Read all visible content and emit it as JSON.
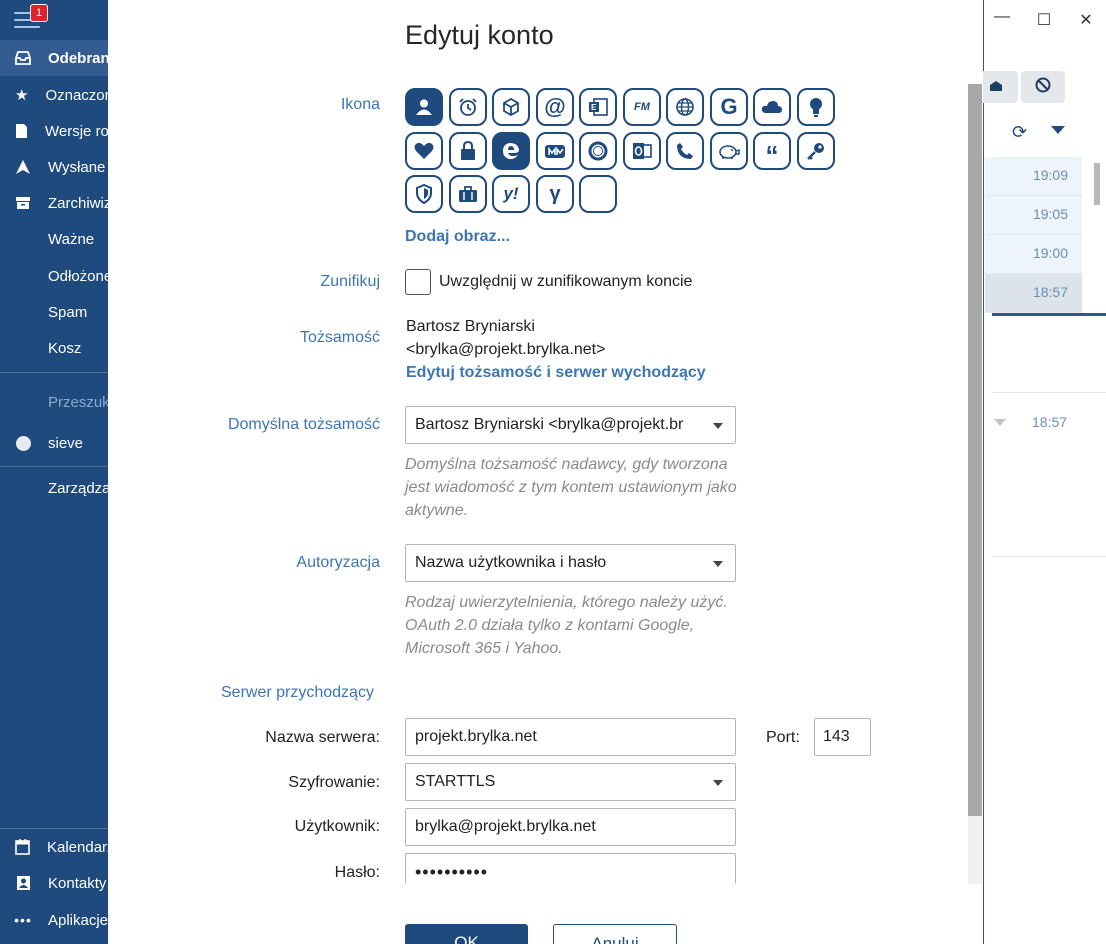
{
  "sidebar": {
    "badge_count": "1",
    "items": [
      {
        "label": "Odebrane",
        "icon": "inbox-icon"
      },
      {
        "label": "Oznaczone",
        "icon": "star-icon"
      },
      {
        "label": "Wersje robocze",
        "icon": "draft-icon"
      },
      {
        "label": "Wysłane",
        "icon": "sent-icon"
      },
      {
        "label": "Zarchiwizowane",
        "icon": "archive-icon"
      },
      {
        "label": "Ważne"
      },
      {
        "label": "Odłożone"
      },
      {
        "label": "Spam"
      },
      {
        "label": "Kosz"
      },
      {
        "label": "Przeszukaj"
      },
      {
        "label": "sieve"
      },
      {
        "label": "Zarządzaj"
      }
    ],
    "bottom_items": [
      {
        "label": "Kalendarz",
        "icon": "calendar-icon"
      },
      {
        "label": "Kontakty",
        "icon": "contacts-icon"
      },
      {
        "label": "Aplikacje",
        "icon": "more-icon"
      }
    ]
  },
  "right_pane": {
    "times": [
      "19:09",
      "19:05",
      "19:00",
      "18:57",
      "18:57"
    ]
  },
  "dialog": {
    "title": "Edytuj konto",
    "icon_label": "Ikona",
    "icons": [
      "person",
      "alarm",
      "cube",
      "at",
      "exchange",
      "fastmail",
      "globe",
      "google",
      "cloud",
      "bulb",
      "heart",
      "lock",
      "edge",
      "mailbox",
      "circle",
      "outlook",
      "phone",
      "piggy",
      "quote",
      "key",
      "shield",
      "briefcase",
      "yahoo",
      "yandex",
      "blank"
    ],
    "add_image": "Dodaj obraz...",
    "unify_label": "Zunifikuj",
    "unify_checkbox_text": "Uwzględnij w zunifikowanym koncie",
    "identity_label": "Tożsamość",
    "identity_name": "Bartosz Bryniarski",
    "identity_email": "<brylka@projekt.brylka.net>",
    "identity_edit_link": "Edytuj tożsamość i serwer wychodzący",
    "default_identity_label": "Domyślna tożsamość",
    "default_identity_value": "Bartosz Bryniarski <brylka@projekt.br",
    "default_identity_hint": "Domyślna tożsamość nadawcy, gdy tworzona jest wiadomość z tym kontem ustawionym jako aktywne.",
    "auth_label": "Autoryzacja",
    "auth_value": "Nazwa użytkownika i hasło",
    "auth_hint": "Rodzaj uwierzytelnienia, którego należy użyć. OAuth 2.0 działa tylko z kontami Google, Microsoft 365 i Yahoo.",
    "incoming_section": "Serwer przychodzący",
    "server_label": "Nazwa serwera:",
    "server_value": "projekt.brylka.net",
    "port_label": "Port:",
    "port_value": "143",
    "encryption_label": "Szyfrowanie:",
    "encryption_value": "STARTTLS",
    "user_label": "Użytkownik:",
    "user_value": "brylka@projekt.brylka.net",
    "password_label": "Hasło:",
    "password_value": "••••••••••",
    "ok_label": "OK",
    "cancel_label": "Anuluj"
  },
  "colors": {
    "brand": "#1e4a7e",
    "link": "#3d76b4"
  }
}
